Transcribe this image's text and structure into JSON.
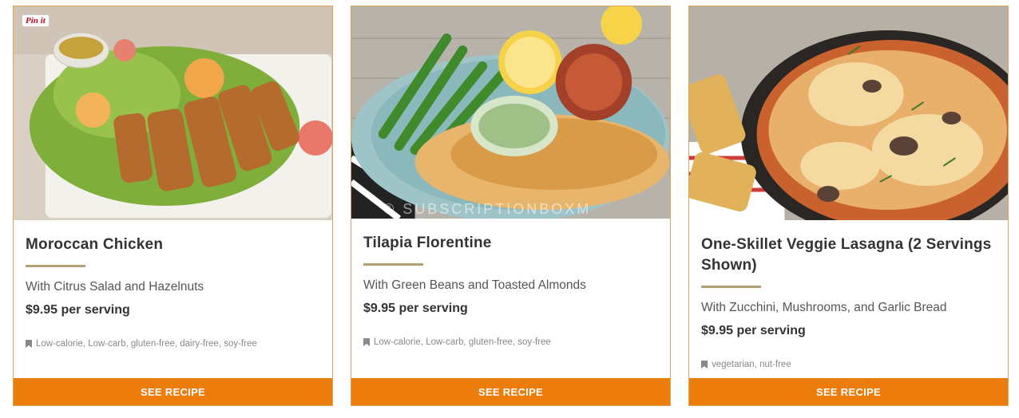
{
  "cards": [
    {
      "title": "Moroccan Chicken",
      "subtitle": "With Citrus Salad and Hazelnuts",
      "price": "$9.95 per serving",
      "tags": "Low-calorie, Low-carb, gluten-free, dairy-free, soy-free",
      "cta": "SEE RECIPE",
      "pin_label": "Pin it",
      "image_icon": "moroccan-chicken-photo"
    },
    {
      "title": "Tilapia Florentine",
      "subtitle": "With Green Beans and Toasted Almonds",
      "price": "$9.95 per serving",
      "tags": "Low-calorie, Low-carb, gluten-free, soy-free",
      "cta": "SEE RECIPE",
      "watermark": "© SUBSCRIPTIONBOXM",
      "image_icon": "tilapia-florentine-photo"
    },
    {
      "title": "One-Skillet Veggie Lasagna (2 Servings Shown)",
      "subtitle": "With Zucchini, Mushrooms, and Garlic Bread",
      "price": "$9.95 per serving",
      "tags": "vegetarian, nut-free",
      "cta": "SEE RECIPE",
      "image_icon": "veggie-lasagna-photo"
    }
  ],
  "colors": {
    "accent": "#ec7c0c",
    "rule": "#b1a072",
    "border": "#d9a55a"
  }
}
